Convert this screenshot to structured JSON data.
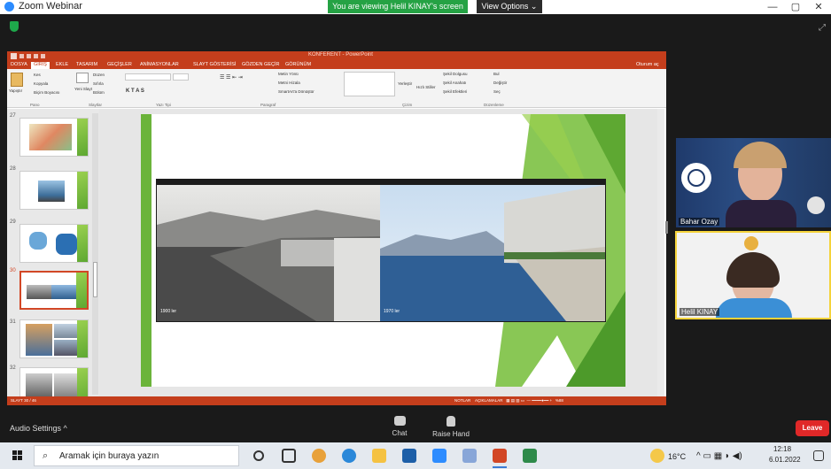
{
  "window": {
    "title": "Zoom Webinar",
    "banner": "You are viewing Helil KINAY's screen",
    "view_options": "View Options ⌄",
    "min": "—",
    "max": "▢",
    "close": "✕"
  },
  "colors": {
    "zoom_green": "#25a244",
    "ppt_accent": "#c43e1c",
    "slide_green": "#5ea832",
    "leave_red": "#e02828"
  },
  "ppt": {
    "doc_title": "KONFERENT - PowerPoint",
    "tabs": [
      "DOSYA",
      "GİRİŞ",
      "EKLE",
      "TASARIM",
      "GEÇİŞLER",
      "ANİMASYONLAR",
      "SLAYT GÖSTERİSİ",
      "GÖZDEN GEÇİR",
      "GÖRÜNÜM"
    ],
    "account": "Oturum aç",
    "ribbon": {
      "paste": "Yapıştır",
      "cut": "Kes",
      "copy": "Kopyala",
      "format_painter": "Biçim Boyacısı",
      "new_slide": "Yeni Slayt",
      "layout": "Düzen",
      "reset": "Sıfırla",
      "section": "Bölüm",
      "text_direction": "Metin Yönü",
      "align_text": "Metni Hizala",
      "smartart": "SmartArt'a Dönüştür",
      "arrange": "Yerleştir",
      "quick_styles": "Hızlı Stiller",
      "shape_fill": "Şekil Dolgusu",
      "shape_outline": "Şekil Anahatı",
      "shape_effects": "Şekil Efektleri",
      "find": "Bul",
      "replace": "Değiştir",
      "select": "Seç",
      "groups": [
        "Pano",
        "Slaytlar",
        "Yazı Tipi",
        "Paragraf",
        "Çizim",
        "Düzenleme"
      ]
    },
    "thumbnails": [
      {
        "num": "27",
        "selected": false
      },
      {
        "num": "28",
        "selected": false
      },
      {
        "num": "29",
        "selected": false
      },
      {
        "num": "30",
        "selected": true
      },
      {
        "num": "31",
        "selected": false
      },
      {
        "num": "32",
        "selected": false
      }
    ],
    "slide": {
      "photo_left_caption": "1900 ler",
      "photo_right_caption": "1970 ler"
    },
    "status": {
      "slide_counter": "SLAYT 30 / 46",
      "notes": "NOTLAR",
      "comments": "AÇIKLAMALAR",
      "zoom": "%88"
    }
  },
  "participants": [
    {
      "name": "Bahar Ozay"
    },
    {
      "name": "Helil KINAY"
    }
  ],
  "toolbar": {
    "audio_settings": "Audio Settings ^",
    "chat": "Chat",
    "raise_hand": "Raise Hand",
    "leave": "Leave"
  },
  "taskbar": {
    "search_placeholder": "Aramak için buraya yazın",
    "temperature": "16°C",
    "time": "12:18",
    "date": "6.01.2022"
  }
}
